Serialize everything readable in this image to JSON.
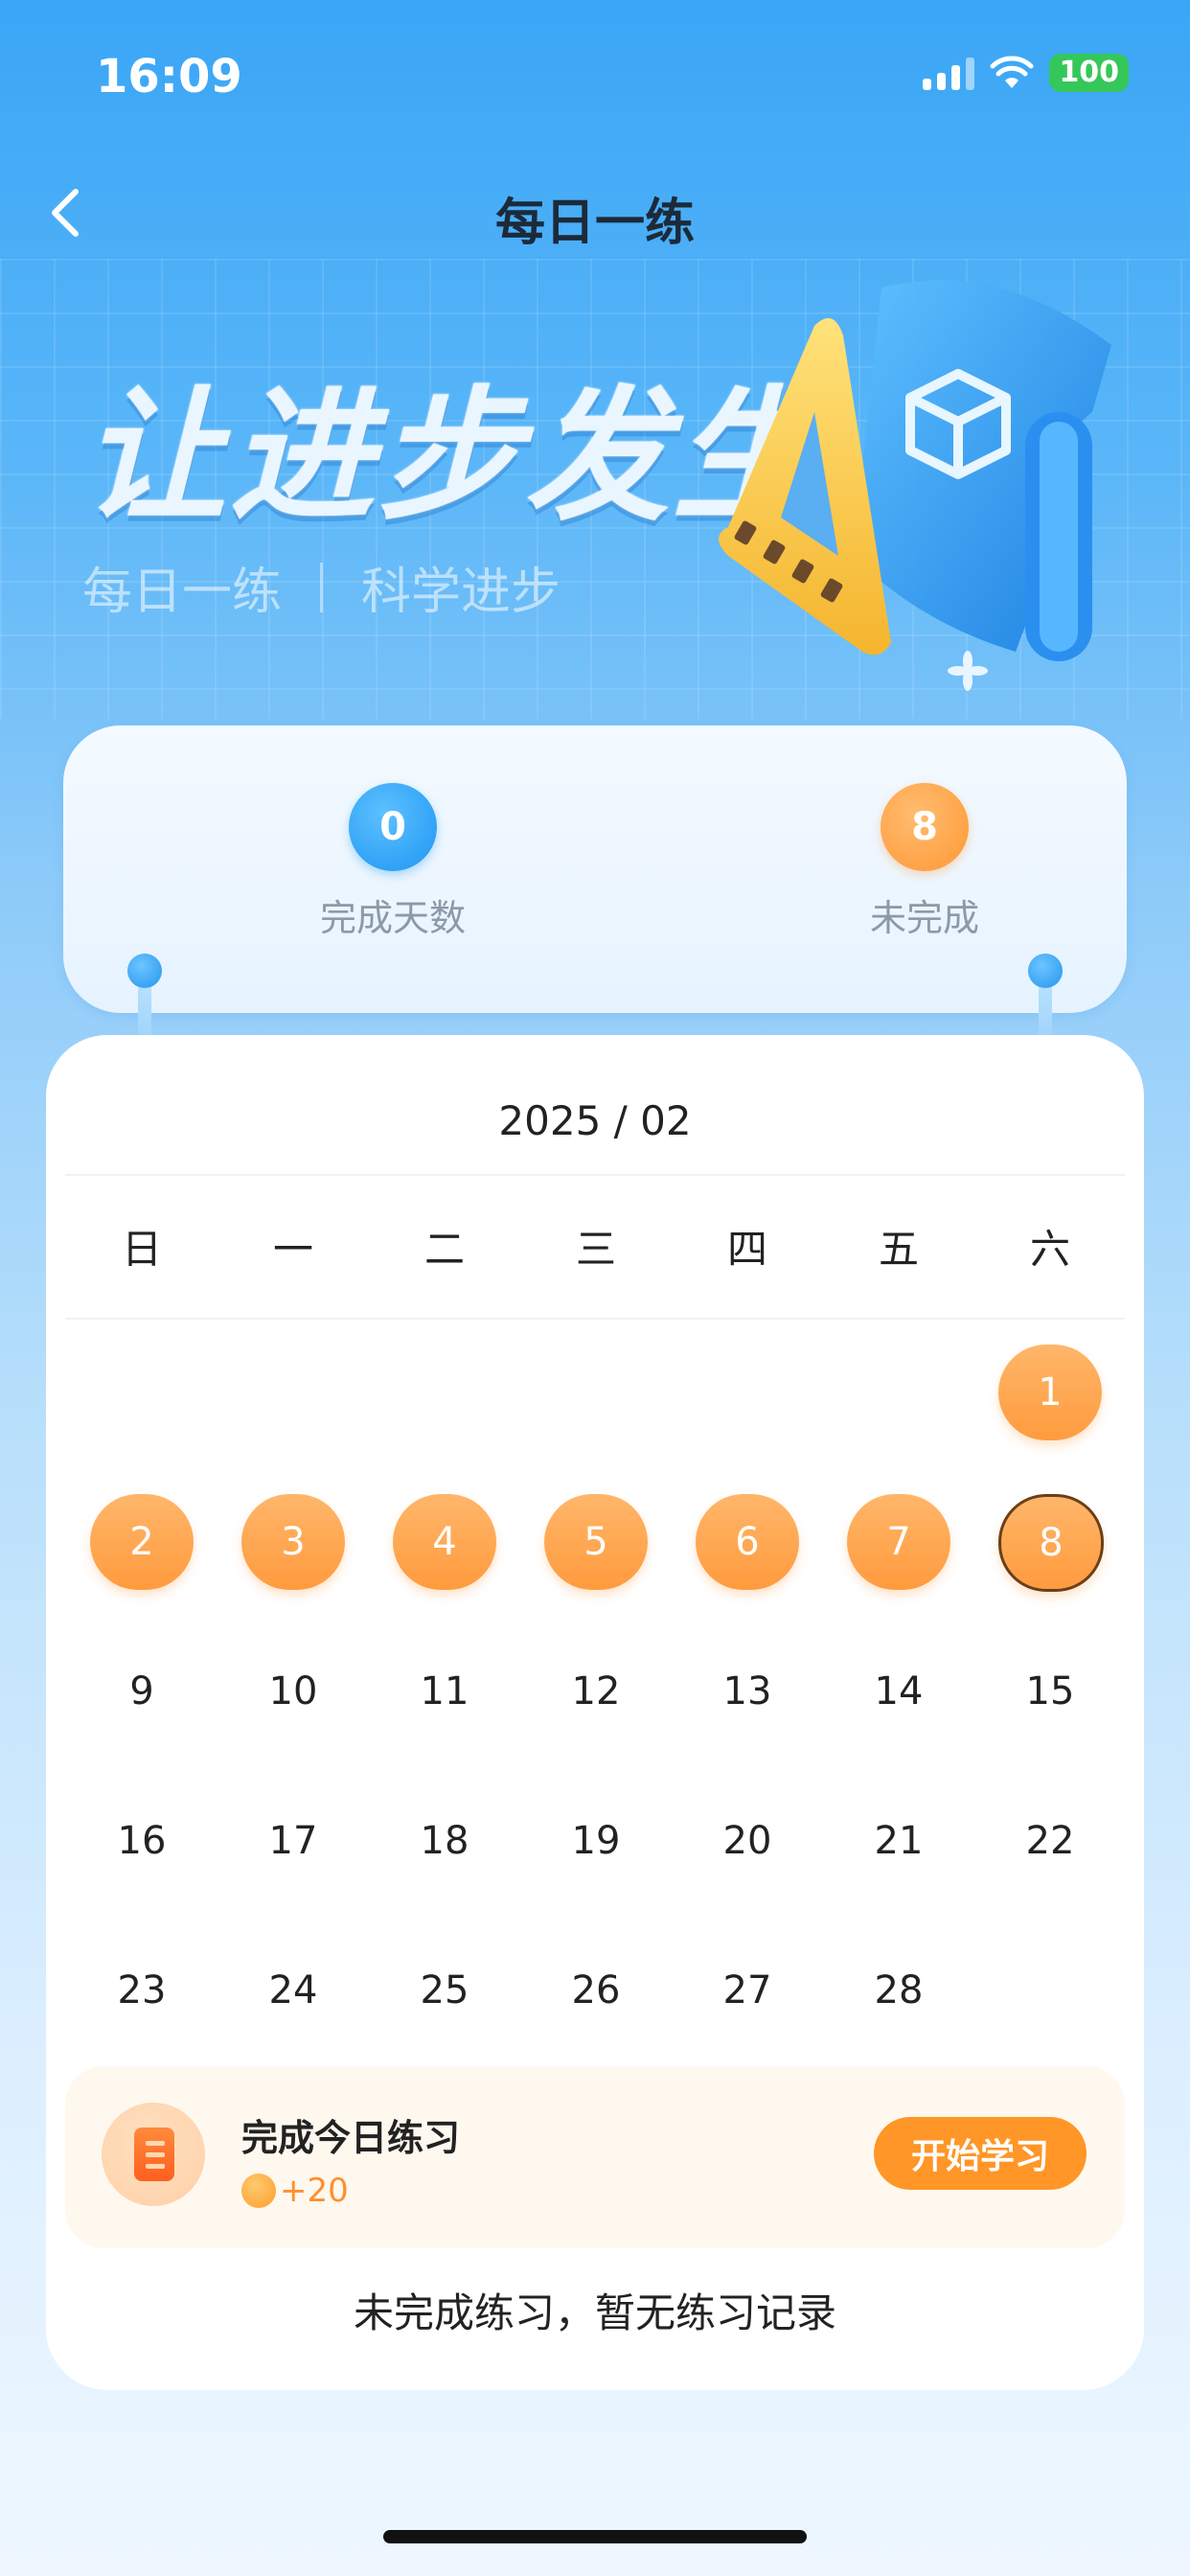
{
  "status_bar": {
    "time": "16:09",
    "battery": "100"
  },
  "nav": {
    "title": "每日一练"
  },
  "hero": {
    "title": "让进步发生",
    "sub_left": "每日一练",
    "sub_right": "科学进步"
  },
  "stats": {
    "completed_value": "0",
    "completed_label": "完成天数",
    "incomplete_value": "8",
    "incomplete_label": "未完成"
  },
  "calendar": {
    "month": "2025 / 02",
    "weekdays": [
      "日",
      "一",
      "二",
      "三",
      "四",
      "五",
      "六"
    ],
    "weeks": [
      [
        "",
        "",
        "",
        "",
        "",
        "",
        "1"
      ],
      [
        "2",
        "3",
        "4",
        "5",
        "6",
        "7",
        "8"
      ],
      [
        "9",
        "10",
        "11",
        "12",
        "13",
        "14",
        "15"
      ],
      [
        "16",
        "17",
        "18",
        "19",
        "20",
        "21",
        "22"
      ],
      [
        "23",
        "24",
        "25",
        "26",
        "27",
        "28",
        ""
      ]
    ],
    "incomplete_days": [
      "1",
      "2",
      "3",
      "4",
      "5",
      "6",
      "7",
      "8"
    ],
    "today": "8"
  },
  "task": {
    "title": "完成今日练习",
    "reward": "+20",
    "button": "开始学习"
  },
  "empty_message": "未完成练习，暂无练习记录",
  "colors": {
    "accent_orange": "#ff9627",
    "accent_blue": "#1f95f2"
  }
}
